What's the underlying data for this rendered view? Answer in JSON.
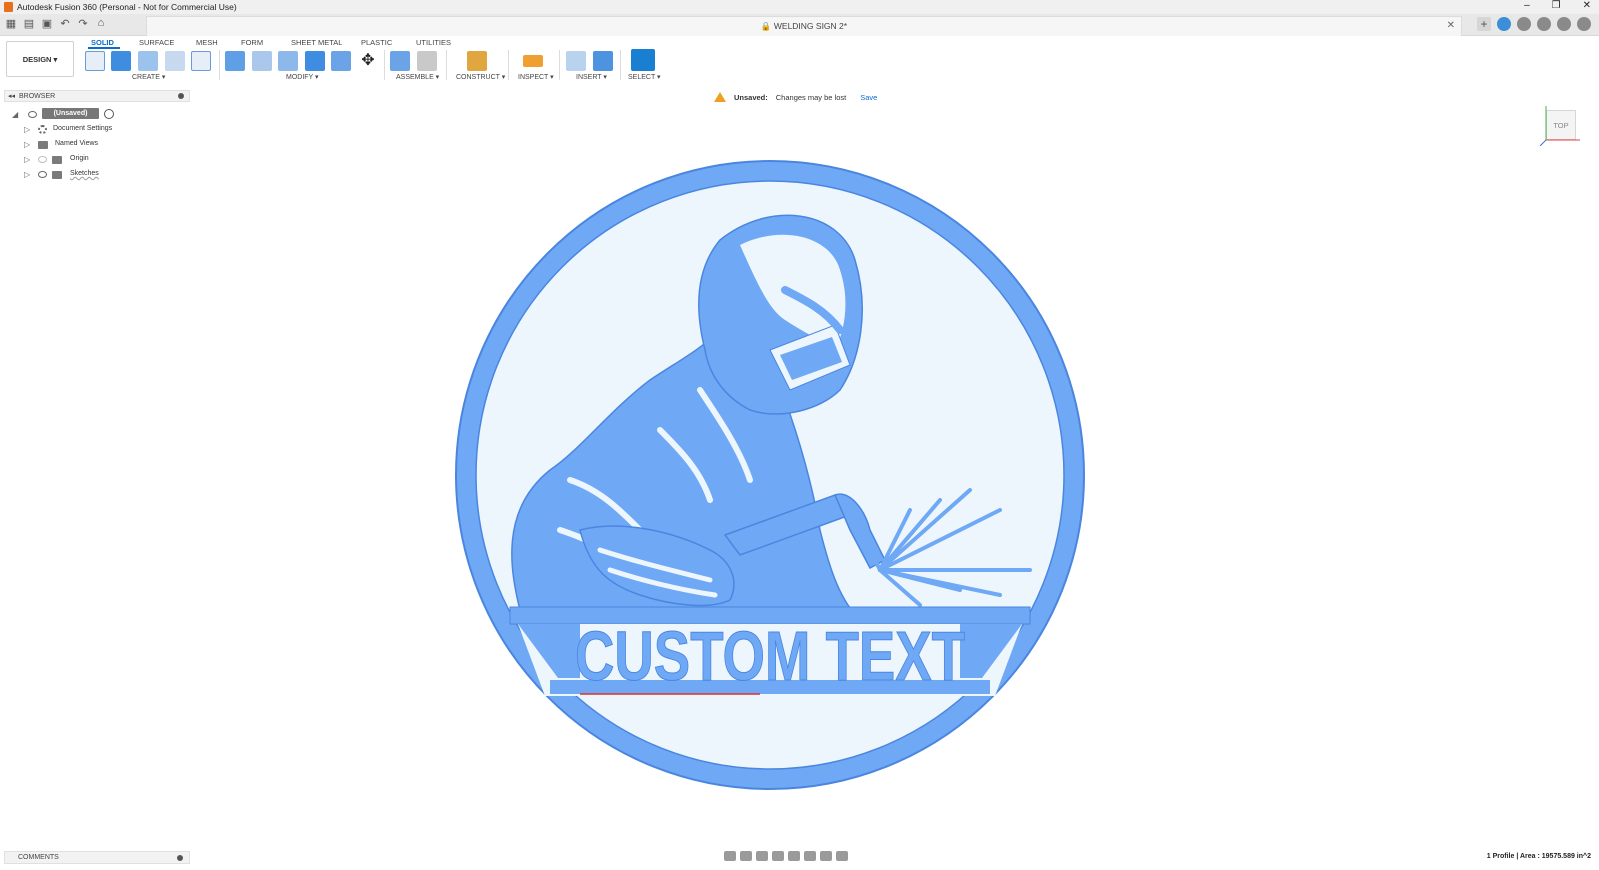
{
  "app": {
    "title": "Autodesk Fusion 360 (Personal - Not for Commercial Use)"
  },
  "document": {
    "title": "WELDING SIGN 2*"
  },
  "workspace": {
    "label": "DESIGN ▾"
  },
  "tabs": [
    {
      "label": "SOLID",
      "active": true
    },
    {
      "label": "SURFACE"
    },
    {
      "label": "MESH"
    },
    {
      "label": "FORM"
    },
    {
      "label": "SHEET METAL"
    },
    {
      "label": "PLASTIC"
    },
    {
      "label": "UTILITIES"
    }
  ],
  "groups": {
    "create": "CREATE ▾",
    "modify": "MODIFY ▾",
    "assemble": "ASSEMBLE ▾",
    "construct": "CONSTRUCT ▾",
    "inspect": "INSPECT ▾",
    "insert": "INSERT ▾",
    "select": "SELECT ▾"
  },
  "browser": {
    "title": "BROWSER",
    "root": "(Unsaved)",
    "items": [
      "Document Settings",
      "Named Views",
      "Origin",
      "Sketches"
    ]
  },
  "notice": {
    "label": "Unsaved:",
    "message": "Changes may be lost",
    "action": "Save"
  },
  "viewcube": {
    "face": "TOP"
  },
  "design": {
    "text": "CUSTOM TEXT",
    "fill_color": "#6fa8f5",
    "bg_color": "#eef6fd",
    "stroke_color": "#4a86e0"
  },
  "comments": {
    "title": "COMMENTS"
  },
  "status": {
    "text": "1 Profile | Area : 19575.589 in^2"
  }
}
